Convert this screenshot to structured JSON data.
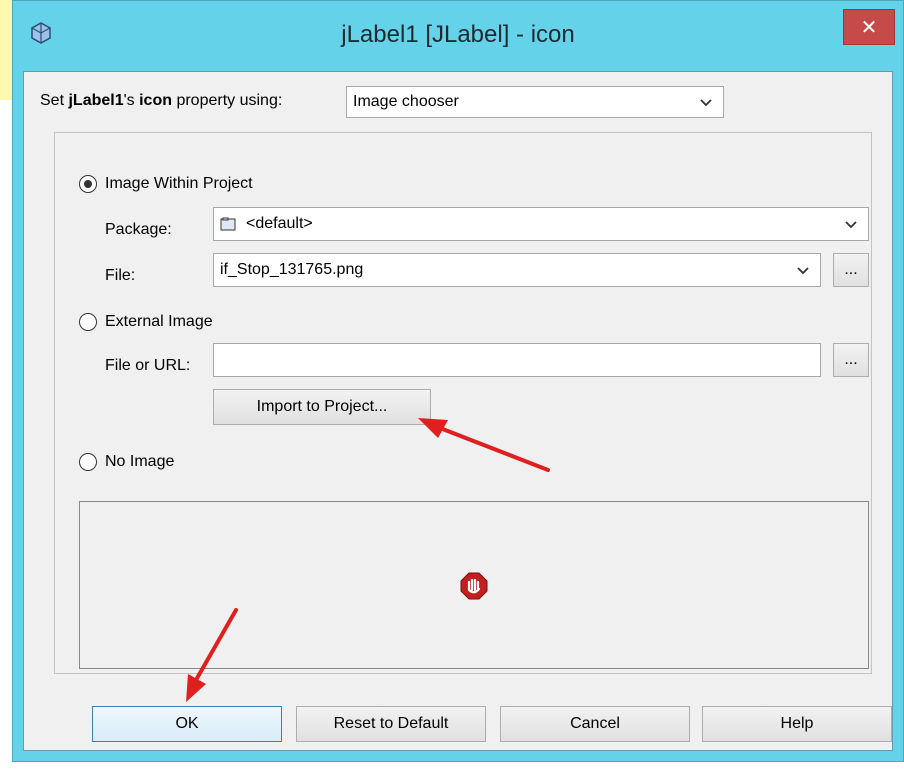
{
  "window": {
    "title": "jLabel1 [JLabel] - icon",
    "close_glyph": "✕"
  },
  "header": {
    "prefix": "Set ",
    "component": "jLabel1",
    "possessive": "'s ",
    "property": "icon",
    "suffix": " property using:",
    "method_value": "Image chooser"
  },
  "image_within_project": {
    "label": "Image Within Project",
    "selected": true,
    "package_label": "Package:",
    "package_value": "<default>",
    "file_label": "File:",
    "file_value": "if_Stop_131765.png",
    "browse_label": "..."
  },
  "external_image": {
    "label": "External Image",
    "selected": false,
    "file_or_url_label": "File or URL:",
    "file_or_url_value": "",
    "browse_label": "...",
    "import_label": "Import to Project..."
  },
  "no_image": {
    "label": "No Image",
    "selected": false
  },
  "buttons": {
    "ok": "OK",
    "reset": "Reset to Default",
    "cancel": "Cancel",
    "help": "Help"
  },
  "colors": {
    "titlebar": "#64d2e9",
    "close": "#c74a4a",
    "annotation_arrow": "#e01f1f"
  }
}
